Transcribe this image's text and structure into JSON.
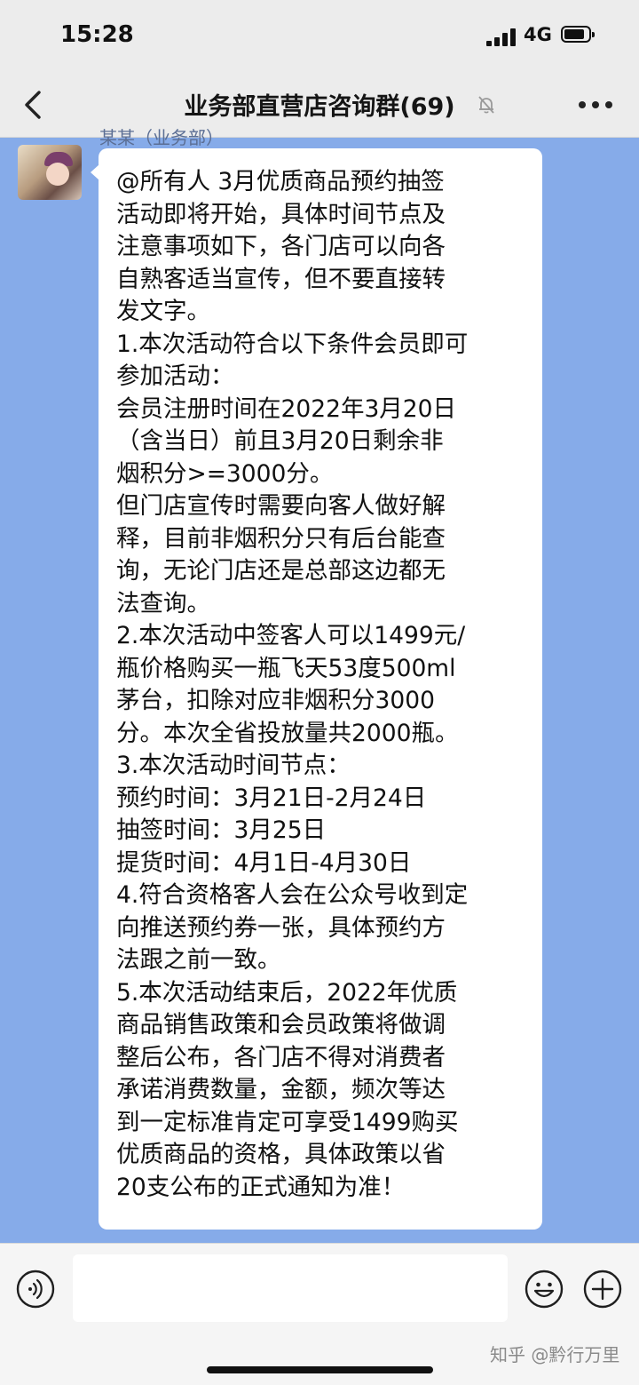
{
  "status_bar": {
    "time": "15:28",
    "network": "4G"
  },
  "header": {
    "title": "业务部直营店咨询群(69)"
  },
  "message": {
    "sender": "某某（业务部）",
    "lines": [
      "@所有人 3月优质商品预约抽签",
      "活动即将开始，具体时间节点及",
      "注意事项如下，各门店可以向各",
      "自熟客适当宣传，但不要直接转",
      "发文字。",
      "1.本次活动符合以下条件会员即可",
      "参加活动：",
      "会员注册时间在2022年3月20日",
      "（含当日）前且3月20日剩余非",
      "烟积分>=3000分。",
      "但门店宣传时需要向客人做好解",
      "释，目前非烟积分只有后台能查",
      "询，无论门店还是总部这边都无",
      "法查询。",
      "2.本次活动中签客人可以1499元/",
      "瓶价格购买一瓶飞天53度500ml",
      "茅台，扣除对应非烟积分3000",
      "分。本次全省投放量共2000瓶。",
      "3.本次活动时间节点：",
      "预约时间：3月21日-2月24日",
      "抽签时间：3月25日",
      "提货时间：4月1日-4月30日",
      "4.符合资格客人会在公众号收到定",
      "向推送预约券一张，具体预约方",
      "法跟之前一致。",
      "5.本次活动结束后，2022年优质",
      "商品销售政策和会员政策将做调",
      "整后公布，各门店不得对消费者",
      "承诺消费数量，金额，频次等达",
      "到一定标准肯定可享受1499购买",
      "优质商品的资格，具体政策以省",
      "20支公布的正式通知为准！"
    ]
  },
  "input_bar": {
    "watermark": "知乎 @黔行万里"
  },
  "icons": {
    "back": "chevron-left-icon",
    "mute": "bell-muted-icon",
    "more": "more-dots-icon",
    "voice": "voice-icon",
    "emoji": "emoji-icon",
    "plus": "plus-icon"
  },
  "colors": {
    "chat_background": "#86abe9",
    "bar_background": "#ececec",
    "bubble": "#ffffff"
  }
}
